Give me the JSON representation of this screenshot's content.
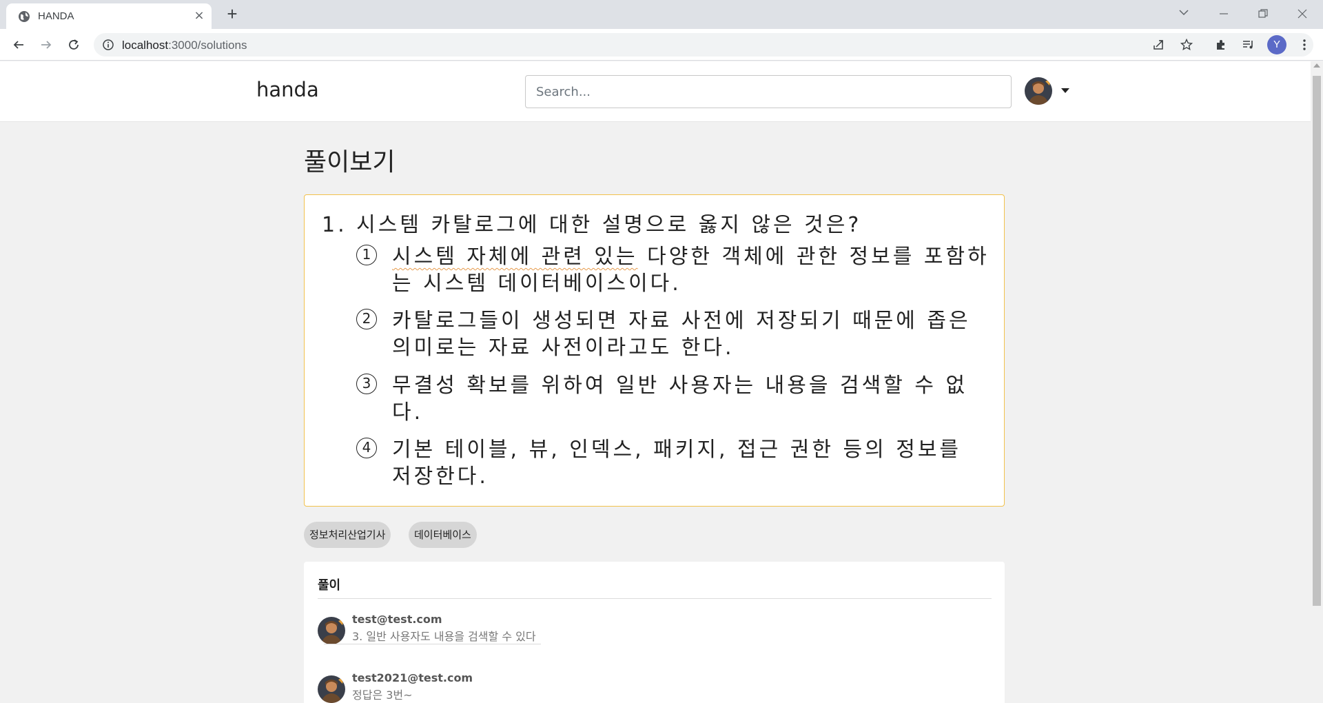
{
  "browser": {
    "tab_title": "HANDA",
    "url_host": "localhost",
    "url_path": ":3000/solutions",
    "profile_initial": "Y"
  },
  "navbar": {
    "brand": "handa",
    "search_placeholder": "Search..."
  },
  "page": {
    "title": "풀이보기"
  },
  "question": {
    "stem": "1. 시스템 카탈로그에 대한 설명으로 옳지 않은 것은?",
    "options": [
      {
        "num": "1",
        "text_underlined": "시스템 자체에 관련 있는",
        "text": " 다양한 객체에 관한 정보를 포함하는 시스템 데이터베이스이다."
      },
      {
        "num": "2",
        "text": "카탈로그들이 생성되면 자료 사전에 저장되기 때문에 좁은 의미로는 자료 사전이라고도 한다."
      },
      {
        "num": "3",
        "text": "무결성 확보를 위하여 일반 사용자는 내용을 검색할 수 없다."
      },
      {
        "num": "4",
        "text": "기본 테이블, 뷰, 인덱스, 패키지, 접근 권한 등의 정보를 저장한다."
      }
    ]
  },
  "tags": [
    "정보처리산업기사",
    "데이터베이스"
  ],
  "solutions": {
    "title": "풀이",
    "comments": [
      {
        "author": "test@test.com",
        "text": "3. 일반 사용자도 내용을 검색할 수 있다"
      },
      {
        "author": "test2021@test.com",
        "text": "정답은 3번~"
      }
    ]
  },
  "colors": {
    "question_border": "#f2c14b",
    "tag_bg": "#d6d6d6",
    "page_bg": "#f1f1f1",
    "profile_avatar_bg": "#5b6ac7"
  }
}
